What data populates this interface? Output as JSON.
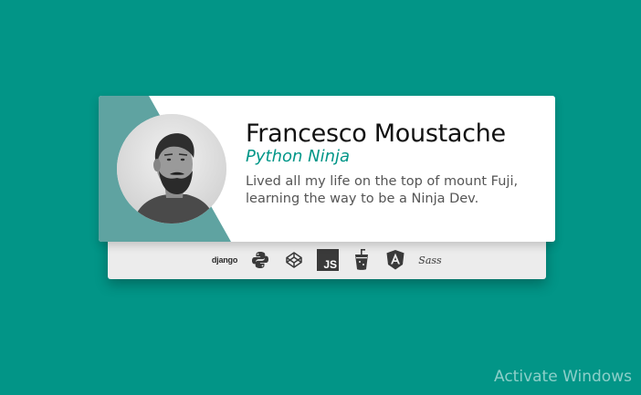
{
  "profile": {
    "name": "Francesco Moustache",
    "role": "Python Ninja",
    "bio": "Lived all my life on the top of mount Fuji, learning the way to be a Ninja Dev."
  },
  "skills": {
    "django_label": "django",
    "js_label": "JS",
    "sass_label": "Sass",
    "icons": [
      "django-icon",
      "python-icon",
      "codepen-icon",
      "javascript-icon",
      "gulp-icon",
      "angular-icon",
      "sass-icon"
    ]
  },
  "watermark": {
    "text": "Activate Windows"
  },
  "colors": {
    "background": "#009688",
    "accent": "#009688",
    "stripe": "#5fa3a1",
    "card": "#ffffff",
    "skills_bar": "#ececec"
  }
}
